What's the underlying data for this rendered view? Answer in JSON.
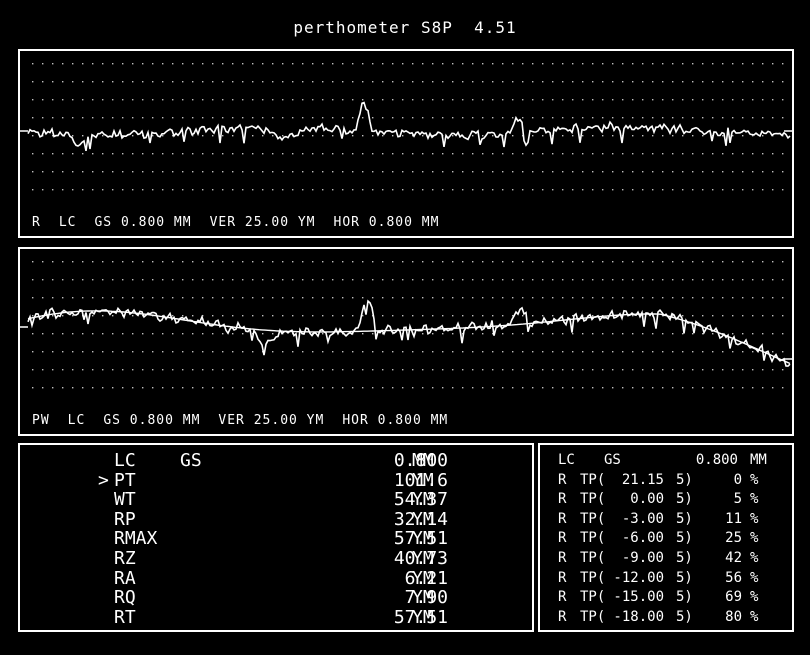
{
  "title": "perthometer S8P  4.51",
  "profile_r": {
    "label": "R",
    "lc": "LC",
    "gs": "GS 0.800 MM",
    "ver": "VER 25.00 YM",
    "hor": "HOR 0.800 MM"
  },
  "profile_pw": {
    "label": "PW",
    "lc": "LC",
    "gs": "GS 0.800 MM",
    "ver": "VER 25.00 YM",
    "hor": "HOR 0.800 MM"
  },
  "params": {
    "rows": [
      {
        "marker": "",
        "name": "LC",
        "extra": "GS",
        "value": "0.800",
        "unit": "MM"
      },
      {
        "marker": ">",
        "name": "PT",
        "extra": "",
        "value": "101.6",
        "unit": "YM"
      },
      {
        "marker": "",
        "name": "WT",
        "extra": "",
        "value": "54.37",
        "unit": "YM"
      },
      {
        "marker": "",
        "name": "RP",
        "extra": "",
        "value": "32.14",
        "unit": "YM"
      },
      {
        "marker": "",
        "name": "RMAX",
        "extra": "",
        "value": "57.51",
        "unit": "YM"
      },
      {
        "marker": "",
        "name": "RZ",
        "extra": "",
        "value": "40.73",
        "unit": "YM"
      },
      {
        "marker": "",
        "name": "RA",
        "extra": "",
        "value": "6.21",
        "unit": "YM"
      },
      {
        "marker": "",
        "name": "RQ",
        "extra": "",
        "value": "7.90",
        "unit": "YM"
      },
      {
        "marker": "",
        "name": "RT",
        "extra": "",
        "value": "57.51",
        "unit": "YM"
      }
    ]
  },
  "bearing": {
    "header": {
      "lc": "LC",
      "gs": "GS",
      "value": "0.800",
      "unit": "MM"
    },
    "rows": [
      {
        "r": "R",
        "tp": "TP(",
        "level": "21.15",
        "n": "5)",
        "pct": "0",
        "sym": "%"
      },
      {
        "r": "R",
        "tp": "TP(",
        "level": "0.00",
        "n": "5)",
        "pct": "5",
        "sym": "%"
      },
      {
        "r": "R",
        "tp": "TP(",
        "level": "-3.00",
        "n": "5)",
        "pct": "11",
        "sym": "%"
      },
      {
        "r": "R",
        "tp": "TP(",
        "level": "-6.00",
        "n": "5)",
        "pct": "25",
        "sym": "%"
      },
      {
        "r": "R",
        "tp": "TP(",
        "level": "-9.00",
        "n": "5)",
        "pct": "42",
        "sym": "%"
      },
      {
        "r": "R",
        "tp": "TP(",
        "level": "-12.00",
        "n": "5)",
        "pct": "56",
        "sym": "%"
      },
      {
        "r": "R",
        "tp": "TP(",
        "level": "-15.00",
        "n": "5)",
        "pct": "69",
        "sym": "%"
      },
      {
        "r": "R",
        "tp": "TP(",
        "level": "-18.00",
        "n": "5)",
        "pct": "80",
        "sym": "%"
      }
    ]
  },
  "colors": {
    "background": "#000000",
    "foreground": "#ffffff"
  }
}
